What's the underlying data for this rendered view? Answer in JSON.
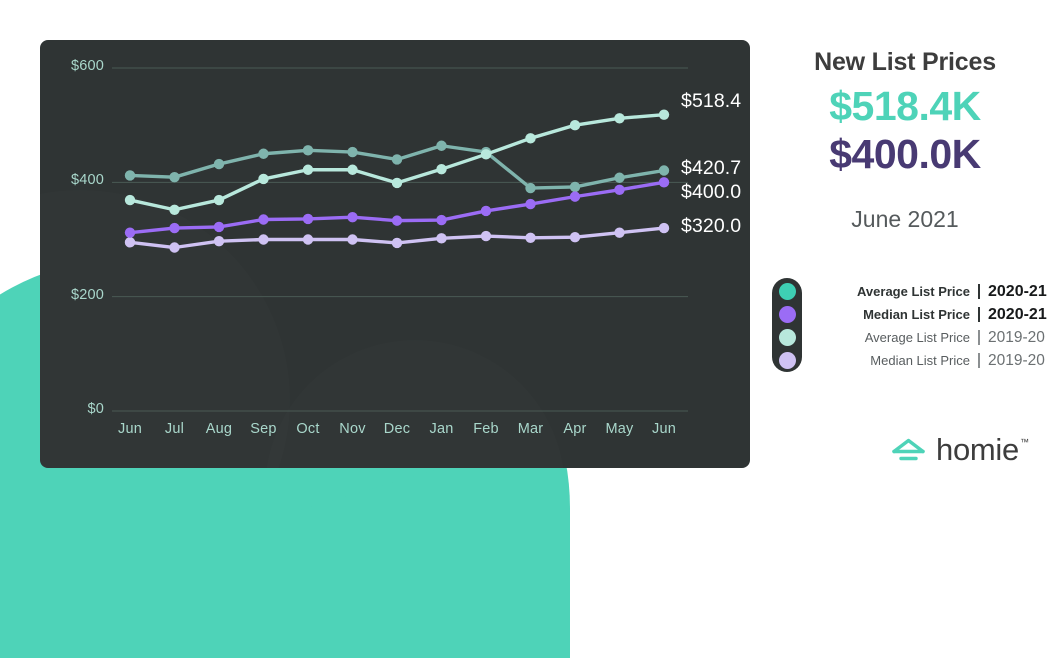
{
  "brand": {
    "name": "homie",
    "trademark": "™",
    "logo_icon": "house-roof-icon",
    "accent_teal": "#4ed3b8",
    "accent_purple": "#483a73",
    "panel_bg": "#2f3434"
  },
  "summary": {
    "headline": "New List Prices",
    "average_value": "$518.4K",
    "median_value": "$400.0K",
    "period": "June 2021"
  },
  "legend": {
    "rows": [
      {
        "name": "Average List Price",
        "divider": "|",
        "year": "2020-21",
        "color": "#3ecfb4",
        "emphasis": true
      },
      {
        "name": "Median List Price",
        "divider": "|",
        "year": "2020-21",
        "color": "#9b6cf5",
        "emphasis": true
      },
      {
        "name": "Average List Price",
        "divider": "|",
        "year": "2019-20",
        "color": "#b8e8dc",
        "emphasis": false
      },
      {
        "name": "Median List Price",
        "divider": "|",
        "year": "2019-20",
        "color": "#cfc2f3",
        "emphasis": false
      }
    ]
  },
  "chart_data": {
    "type": "line",
    "title": "New List Prices",
    "xlabel": "",
    "ylabel": "",
    "grid": true,
    "legend_position": "right",
    "categories": [
      "Jun",
      "Jul",
      "Aug",
      "Sep",
      "Oct",
      "Nov",
      "Dec",
      "Jan",
      "Feb",
      "Mar",
      "Apr",
      "May",
      "Jun"
    ],
    "ylim": [
      0,
      600
    ],
    "yticks": [
      0,
      200,
      400,
      600
    ],
    "ytick_labels": [
      "$0",
      "$200",
      "$400",
      "$600"
    ],
    "series": [
      {
        "name": "Average List Price 2020-21",
        "year": "2020-21",
        "color": "#b8e8dc",
        "end_label": "$518.4",
        "values": [
          369.0,
          352.0,
          369.0,
          406.0,
          422.0,
          422.0,
          399.0,
          423.0,
          449.0,
          477.0,
          500.0,
          512.0,
          518.4
        ]
      },
      {
        "name": "Average List Price 2019-20",
        "year": "2019-20",
        "color": "#7fb4ad",
        "end_label": "$420.7",
        "values": [
          412.0,
          409.0,
          432.0,
          450.0,
          456.0,
          453.0,
          440.0,
          464.0,
          453.0,
          390.0,
          392.0,
          408.0,
          420.7
        ]
      },
      {
        "name": "Median List Price 2020-21",
        "year": "2020-21",
        "color": "#9b6cf5",
        "end_label": "$400.0",
        "values": [
          312.0,
          320.0,
          322.0,
          335.0,
          336.0,
          339.0,
          333.0,
          334.0,
          350.0,
          362.0,
          375.0,
          387.0,
          400.0
        ]
      },
      {
        "name": "Median List Price 2019-20",
        "year": "2019-20",
        "color": "#cfc2f3",
        "end_label": "$320.0",
        "values": [
          295.0,
          286.0,
          297.0,
          300.0,
          300.0,
          300.0,
          294.0,
          302.0,
          306.0,
          303.0,
          304.0,
          312.0,
          320.0
        ]
      }
    ]
  }
}
